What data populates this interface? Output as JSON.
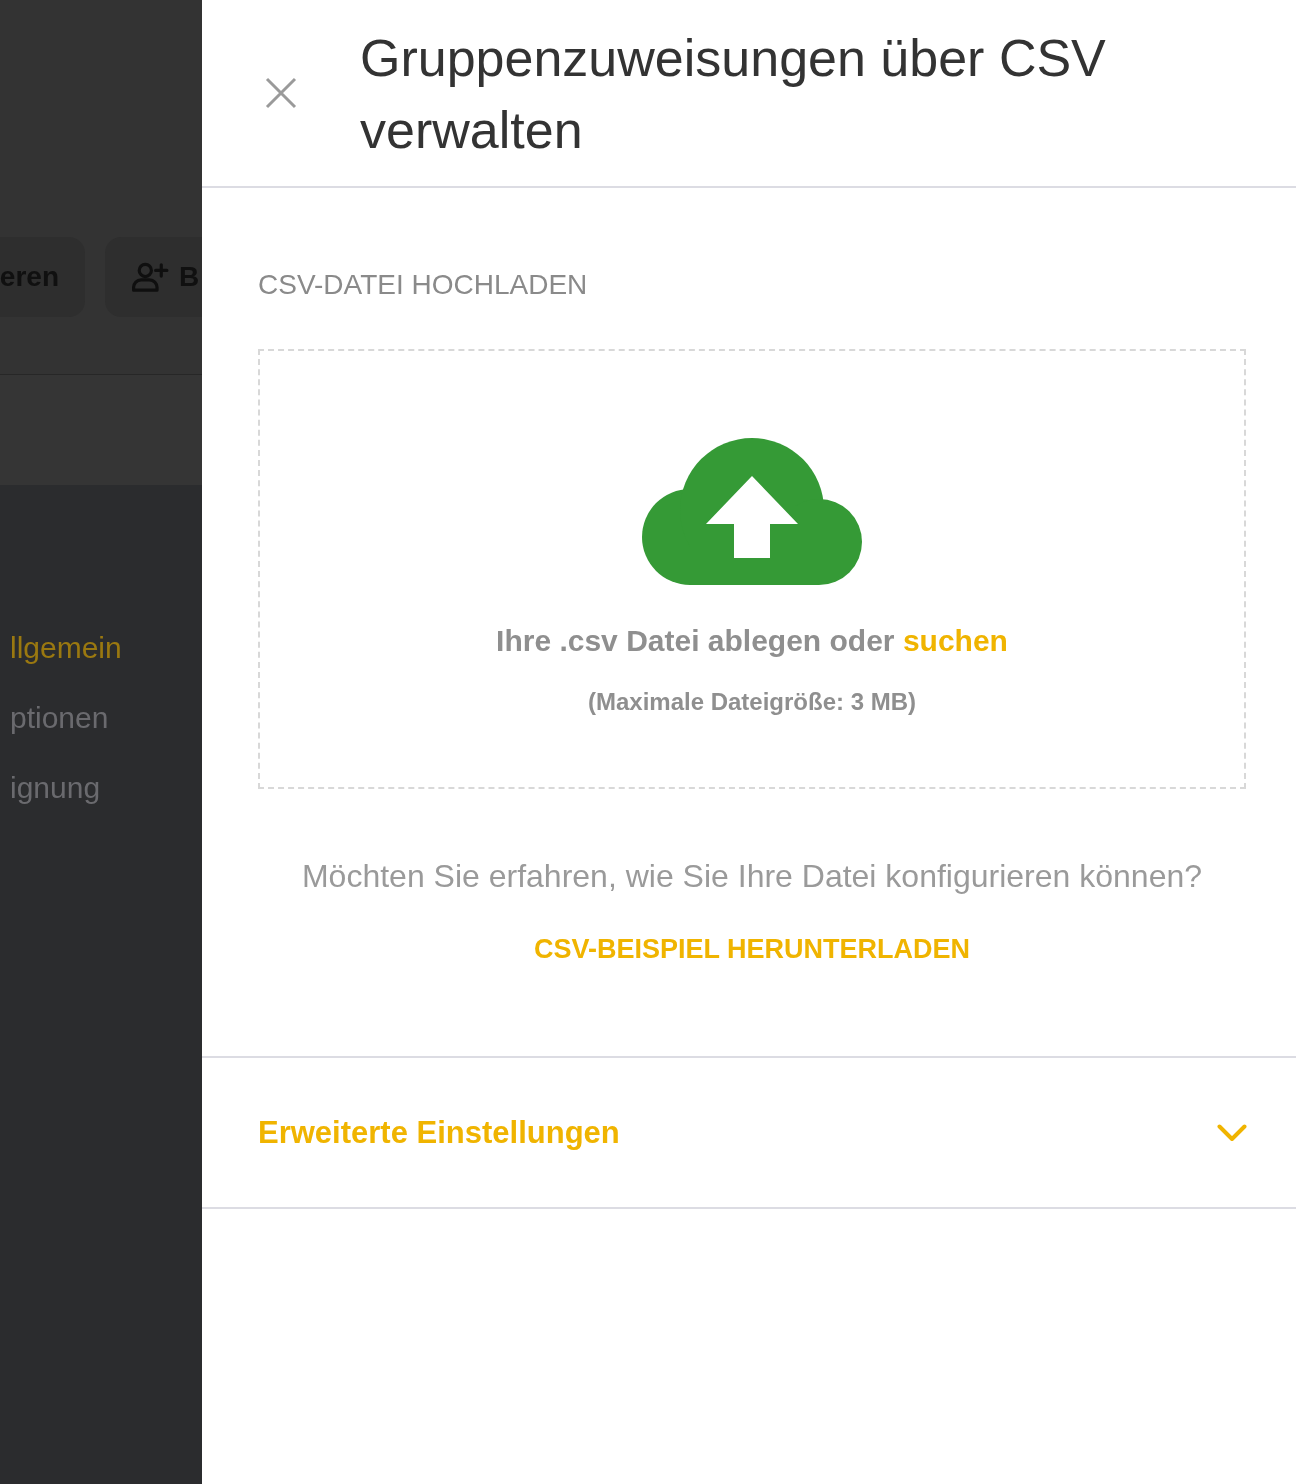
{
  "background": {
    "toolbar_buttons": [
      {
        "kind": "plain",
        "label": "eren"
      },
      {
        "kind": "add_user",
        "label": "B"
      }
    ],
    "nav_items": [
      {
        "label": "llgemein",
        "selected": true
      },
      {
        "label": "ptionen",
        "selected": false
      },
      {
        "label": "ignung",
        "selected": false
      }
    ]
  },
  "panel": {
    "title": "Gruppenzuweisungen über CSV verwalten",
    "section_label": "CSV-DATEI HOCHLADEN",
    "dropzone": {
      "prompt": "Ihre .csv Datei ablegen oder",
      "browse_link": "suchen",
      "hint": "(Maximale Dateigröße: 3 MB)"
    },
    "help_text": "Möchten Sie erfahren, wie Sie Ihre Datei konfigurieren können?",
    "download_link": "CSV-BEISPIEL HERUNTERLADEN",
    "accordion": {
      "label": "Erweiterte Einstellungen",
      "expanded": false
    }
  }
}
